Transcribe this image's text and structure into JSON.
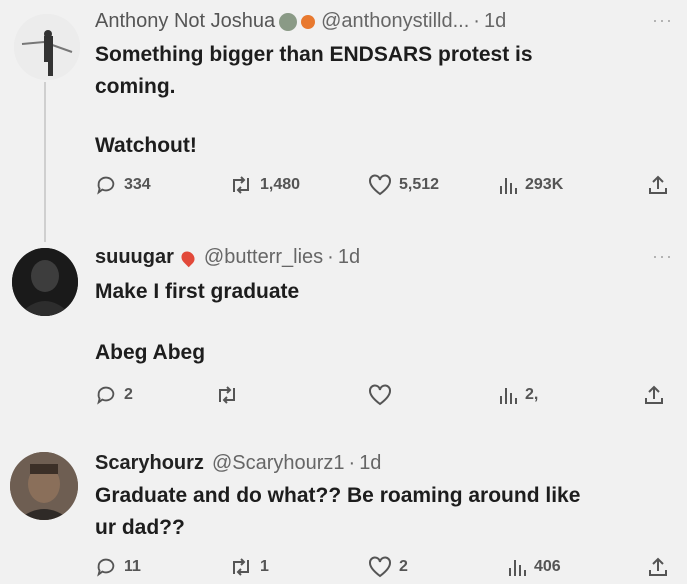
{
  "posts": [
    {
      "name": "Anthony Not Joshua",
      "handle": "@anthonystilld...",
      "time": "1d",
      "text_line1": "Something bigger than ENDSARS protest is",
      "text_line2": "coming.",
      "text_line3": "Watchout!",
      "replies": "334",
      "reposts": "1,480",
      "likes": "5,512",
      "views": "293K"
    },
    {
      "name": "suuugar",
      "handle": "@butterr_lies",
      "time": "1d",
      "text_line1": "Make I first graduate",
      "text_line2": "Abeg Abeg",
      "replies": "2",
      "views": "2,"
    },
    {
      "name": "Scaryhourz",
      "handle": "@Scaryhourz1",
      "time": "1d",
      "text_line1": "Graduate and do what?? Be roaming around like",
      "text_line2": "ur dad??",
      "replies": "11",
      "reposts": "1",
      "likes": "2",
      "views": "406"
    }
  ],
  "separator": "·",
  "more_glyph": "···"
}
